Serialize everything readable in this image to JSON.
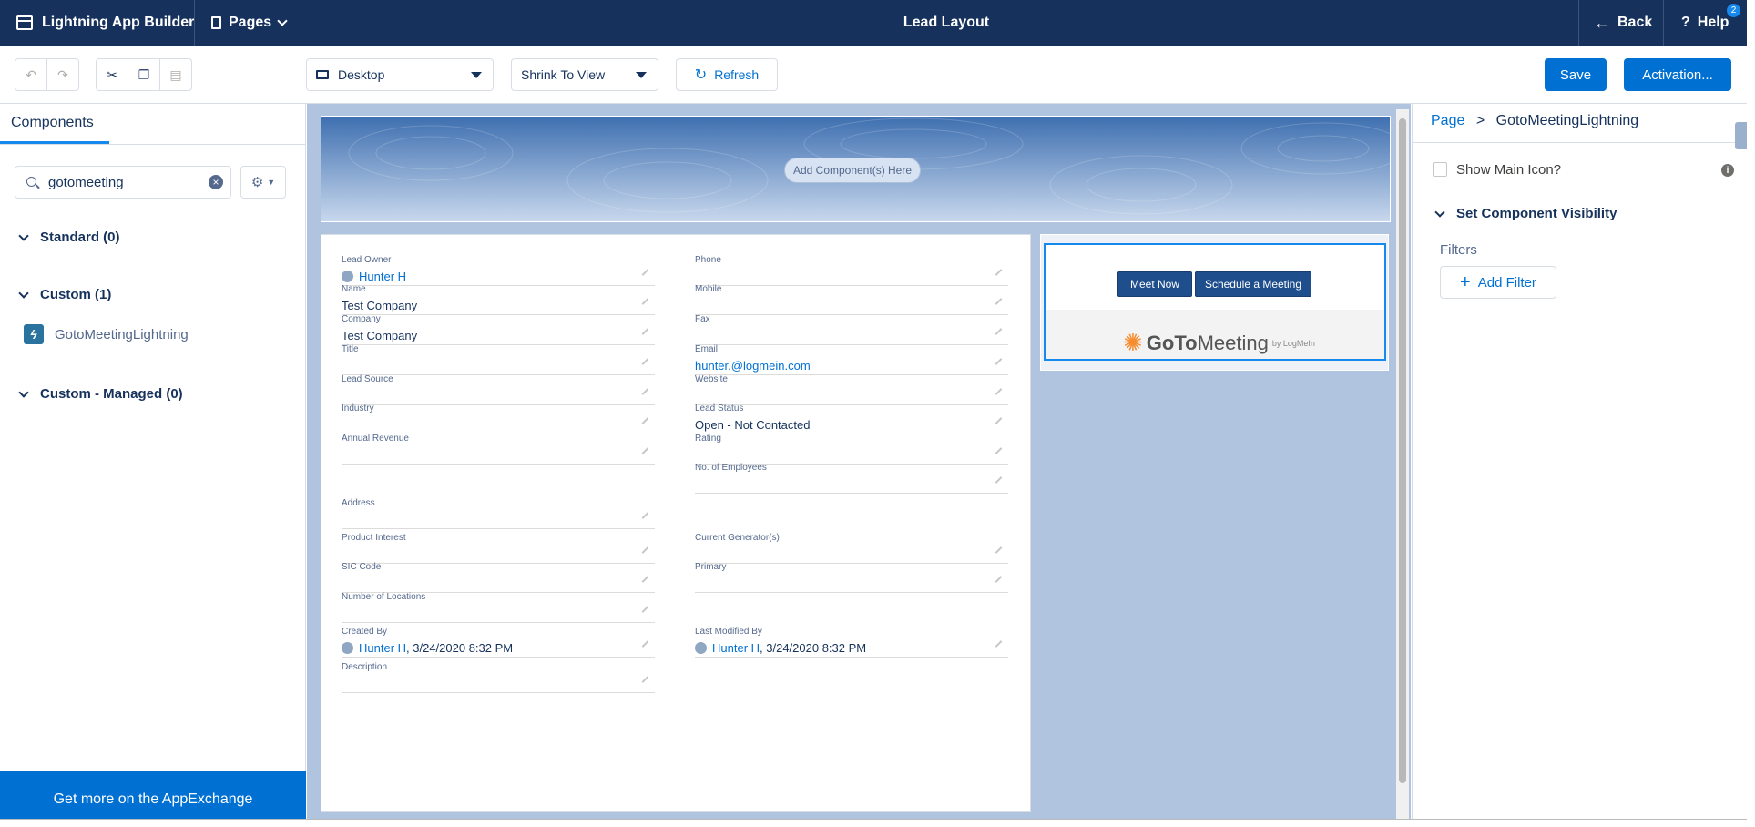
{
  "topbar": {
    "app_title": "Lightning App Builder",
    "pages_label": "Pages",
    "page_title": "Lead Layout",
    "back_label": "Back",
    "help_label": "Help",
    "help_badge": "2"
  },
  "toolbar": {
    "device_select": "Desktop",
    "view_select": "Shrink To View",
    "refresh_label": "Refresh",
    "save_label": "Save",
    "activation_label": "Activation..."
  },
  "left_panel": {
    "tab_label": "Components",
    "search_value": "gotomeeting",
    "sections": [
      {
        "label": "Standard (0)"
      },
      {
        "label": "Custom (1)"
      },
      {
        "label": "Custom - Managed (0)"
      }
    ],
    "custom_item": "GotoMeetingLightning",
    "appexchange_label": "Get more on the AppExchange"
  },
  "canvas": {
    "add_component_label": "Add Component(s) Here",
    "fields_left": [
      {
        "label": "Lead Owner",
        "value": "Hunter H",
        "link": true,
        "user": true
      },
      {
        "label": "Name",
        "value": "Test Company"
      },
      {
        "label": "Company",
        "value": "Test Company"
      },
      {
        "label": "Title",
        "value": ""
      },
      {
        "label": "Lead Source",
        "value": ""
      },
      {
        "label": "Industry",
        "value": ""
      },
      {
        "label": "Annual Revenue",
        "value": ""
      },
      {
        "label": "Address",
        "value": ""
      },
      {
        "label": "Product Interest",
        "value": ""
      },
      {
        "label": "SIC Code",
        "value": ""
      },
      {
        "label": "Number of Locations",
        "value": ""
      },
      {
        "label": "Created By",
        "value": "Hunter H",
        "suffix": ", 3/24/2020 8:32 PM",
        "link": true,
        "user": true
      },
      {
        "label": "Description",
        "value": ""
      }
    ],
    "fields_right": [
      {
        "label": "Phone",
        "value": ""
      },
      {
        "label": "Mobile",
        "value": ""
      },
      {
        "label": "Fax",
        "value": ""
      },
      {
        "label": "Email",
        "value": "hunter.@logmein.com",
        "link": true
      },
      {
        "label": "Website",
        "value": ""
      },
      {
        "label": "Lead Status",
        "value": "Open - Not Contacted"
      },
      {
        "label": "Rating",
        "value": ""
      },
      {
        "label": "No. of Employees",
        "value": ""
      },
      {
        "label": "Current Generator(s)",
        "value": ""
      },
      {
        "label": "Primary",
        "value": ""
      },
      {
        "label": "Last Modified By",
        "value": "Hunter H",
        "suffix": ", 3/24/2020 8:32 PM",
        "link": true,
        "user": true
      }
    ],
    "goto": {
      "meet_now": "Meet Now",
      "schedule": "Schedule a Meeting",
      "logo_goto": "GoTo",
      "logo_meeting": "Meeting",
      "logo_by": "by LogMeIn"
    }
  },
  "right_panel": {
    "crumb_page": "Page",
    "crumb_sep": ">",
    "crumb_current": "GotoMeetingLightning",
    "show_main_icon": "Show Main Icon?",
    "visibility_label": "Set Component Visibility",
    "filters_label": "Filters",
    "add_filter": "Add Filter"
  }
}
